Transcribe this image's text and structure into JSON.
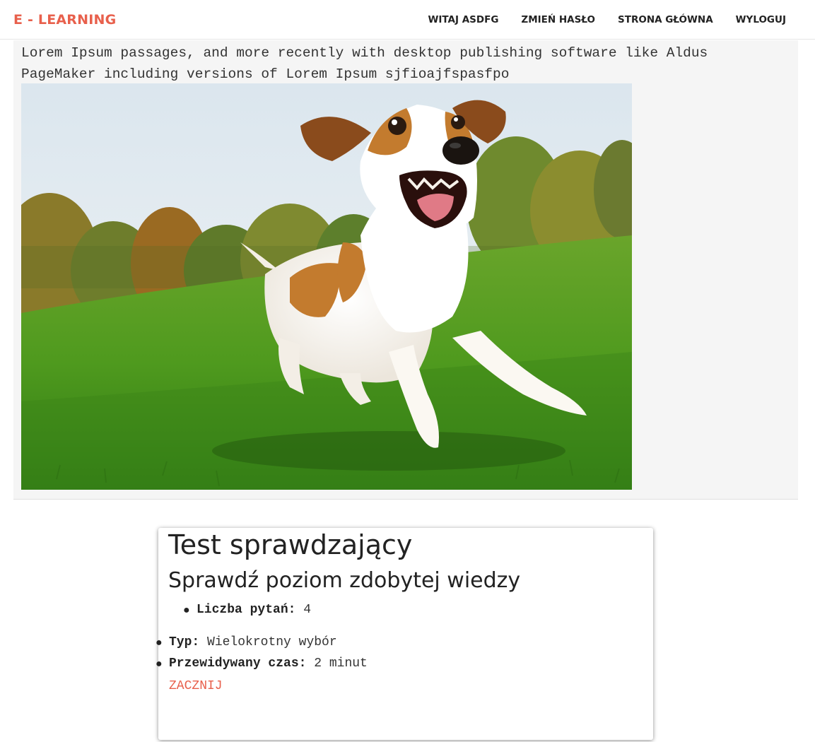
{
  "navbar": {
    "brand": "E - LEARNING",
    "links": [
      {
        "label": "WITAJ ASDFG"
      },
      {
        "label": "ZMIEŃ HASŁO"
      },
      {
        "label": "STRONA GŁÓWNA"
      },
      {
        "label": "WYLOGUJ"
      }
    ]
  },
  "lesson": {
    "text": "Lorem Ipsum passages, and more recently with desktop publishing software like Aldus PageMaker including versions of Lorem Ipsum sjfioajfspasfpo",
    "image": "dog-running-on-grass-photo"
  },
  "test": {
    "title": "Test sprawdzający",
    "subtitle": "Sprawdź poziom zdobytej wiedzy",
    "questions_label": "Liczba pytań:",
    "questions_value": "4",
    "type_label": "Typ:",
    "type_value": "Wielokrotny wybór",
    "time_label": "Przewidywany czas:",
    "time_value": "2 minut",
    "start_label": "ZACZNIJ"
  },
  "colors": {
    "accent": "#e8604c",
    "panel_bg": "#f5f5f5",
    "text": "#333333"
  }
}
